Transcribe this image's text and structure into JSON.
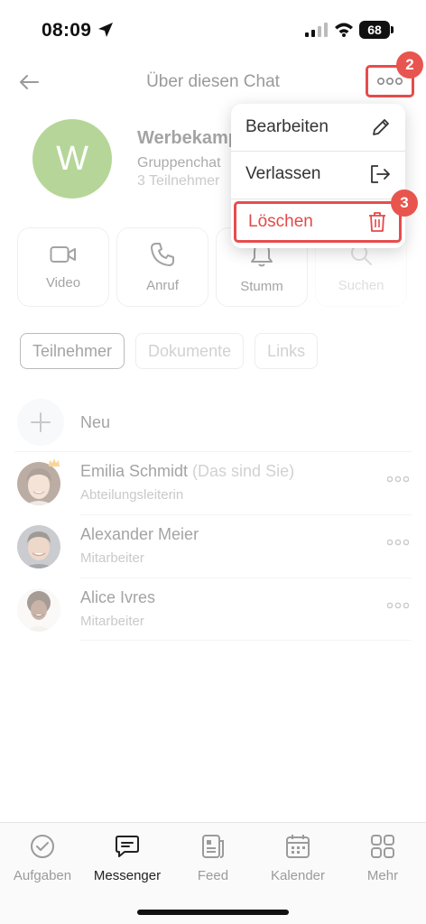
{
  "status_bar": {
    "time": "08:09",
    "battery": "68"
  },
  "header": {
    "title": "Über diesen Chat",
    "badge_more": "2"
  },
  "chat": {
    "avatar_letter": "W",
    "name": "Werbekamp",
    "type": "Gruppenchat",
    "participants": "3 Teilnehmer"
  },
  "actions": [
    {
      "label": "Video",
      "icon": "video-icon"
    },
    {
      "label": "Anruf",
      "icon": "phone-icon"
    },
    {
      "label": "Stumm",
      "icon": "bell-icon"
    },
    {
      "label": "Suchen",
      "icon": "search-icon"
    }
  ],
  "tabs": [
    {
      "label": "Teilnehmer",
      "active": true
    },
    {
      "label": "Dokumente",
      "active": false
    },
    {
      "label": "Links",
      "active": false
    }
  ],
  "new_member": {
    "label": "Neu"
  },
  "members": [
    {
      "name": "Emilia Schmidt",
      "suffix": "(Das sind Sie)",
      "role": "Abteilungsleiterin"
    },
    {
      "name": "Alexander Meier",
      "suffix": "",
      "role": "Mitarbeiter"
    },
    {
      "name": "Alice Ivres",
      "suffix": "",
      "role": "Mitarbeiter"
    }
  ],
  "menu": {
    "edit": "Bearbeiten",
    "leave": "Verlassen",
    "delete": "Löschen",
    "badge_delete": "3"
  },
  "tabbar": [
    {
      "label": "Aufgaben",
      "icon": "check-circle-icon",
      "active": false
    },
    {
      "label": "Messenger",
      "icon": "chat-icon",
      "active": true
    },
    {
      "label": "Feed",
      "icon": "feed-icon",
      "active": false
    },
    {
      "label": "Kalender",
      "icon": "calendar-icon",
      "active": false
    },
    {
      "label": "Mehr",
      "icon": "grid-icon",
      "active": false
    }
  ],
  "colors": {
    "accent_red": "#e74c4c",
    "avatar_green": "#5ca41b"
  }
}
